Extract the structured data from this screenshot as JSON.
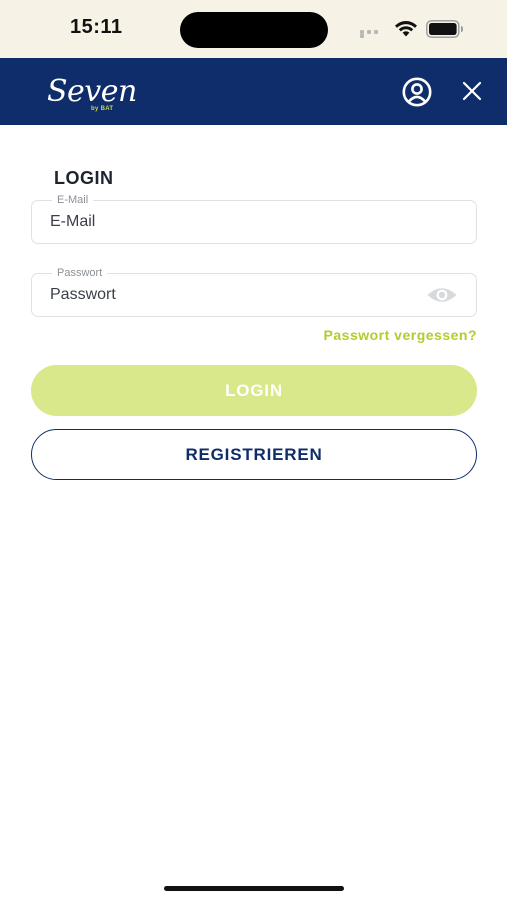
{
  "status_bar": {
    "time": "15:11",
    "icons": [
      "signal-dots-icon",
      "wifi-icon",
      "battery-icon"
    ]
  },
  "header": {
    "logo_text": "Seven",
    "logo_subtext": "by BAT",
    "account_icon": "account-circle-icon",
    "close_icon": "close-icon"
  },
  "login_form": {
    "title": "LOGIN",
    "email": {
      "legend": "E-Mail",
      "placeholder": "E-Mail",
      "value": ""
    },
    "password": {
      "legend": "Passwort",
      "placeholder": "Passwort",
      "value": "",
      "toggle_icon": "eye-icon"
    },
    "forgot_password_label": "Passwort vergessen?",
    "login_button_label": "LOGIN",
    "register_button_label": "REGISTRIEREN"
  },
  "colors": {
    "header_bg": "#0f2d6a",
    "status_bar_bg": "#f6f2e6",
    "accent_green": "#b2cc2e",
    "login_button_bg": "#d8e88a",
    "register_border": "#0f2d6a"
  }
}
